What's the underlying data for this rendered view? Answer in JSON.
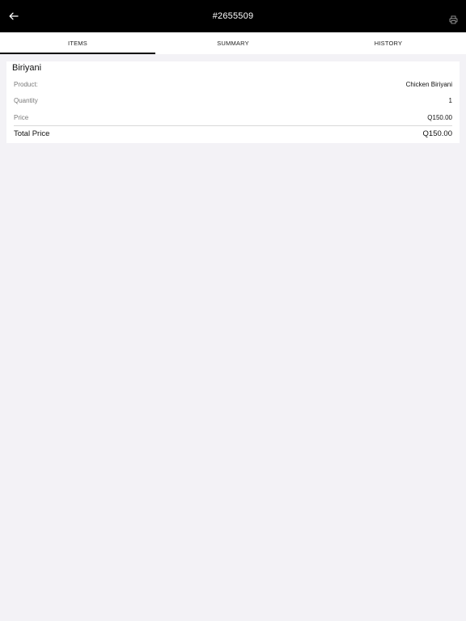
{
  "header": {
    "order_id": "#2655509",
    "back_icon": "arrow-left-icon",
    "print_icon": "printer-icon"
  },
  "tabs": [
    {
      "label": "ITEMS",
      "active": true
    },
    {
      "label": "SUMMARY",
      "active": false
    },
    {
      "label": "HISTORY",
      "active": false
    }
  ],
  "item": {
    "name": "Biriyani",
    "product_label": "Product:",
    "product_value": "Chicken Biriyani",
    "quantity_label": "Quantity",
    "quantity_value": "1",
    "price_label": "Price",
    "price_value": "Q150.00",
    "total_label": "Total Price",
    "total_value": "Q150.00"
  },
  "colors": {
    "header_bg": "#000000",
    "page_bg": "#f3f2f6",
    "card_bg": "#ffffff"
  }
}
